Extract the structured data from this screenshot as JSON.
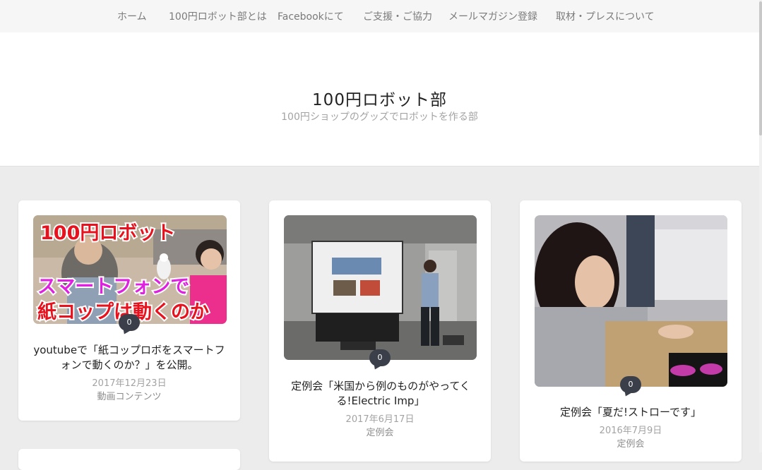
{
  "nav": {
    "items": [
      {
        "label": "ホーム"
      },
      {
        "label": "100円ロボット部とは"
      },
      {
        "label": "Facebookにて"
      },
      {
        "label": "ご支援・ご協力"
      },
      {
        "label": "メールマガジン登録"
      },
      {
        "label": "取材・プレスについて"
      }
    ]
  },
  "site": {
    "title": "100円ロボット部",
    "description": "100円ショップのグッズでロボットを作る部"
  },
  "posts": [
    {
      "thumb_line1": "100円ロボット",
      "thumb_line2": "スマートフォンで",
      "thumb_line3": "紙コップは動くのか",
      "comments": "0",
      "title": "youtubeで「紙コップロボをスマートフォンで動くのか？」を公開。",
      "date": "2017年12月23日",
      "category": "動画コンテンツ"
    },
    {
      "comments": "0",
      "title": "定例会「米国から例のものがやってくる!Electric Imp」",
      "date": "2017年6月17日",
      "category": "定例会"
    },
    {
      "comments": "0",
      "title": "定例会「夏だ!ストローです」",
      "date": "2016年7月9日",
      "category": "定例会"
    }
  ],
  "colors": {
    "accent_magenta": "#e020e0",
    "accent_red": "#e8121e",
    "bubble": "#3a3f4a"
  }
}
